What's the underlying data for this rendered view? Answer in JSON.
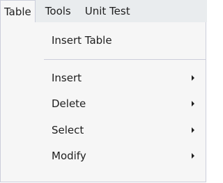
{
  "menubar": {
    "items": [
      {
        "label": "Table",
        "state": "open"
      },
      {
        "label": "Tools"
      },
      {
        "label": "Unit Test"
      }
    ]
  },
  "dropdown": {
    "items": [
      {
        "label": "Insert Table",
        "has_submenu": false
      },
      {
        "label": "Insert",
        "has_submenu": true
      },
      {
        "label": "Delete",
        "has_submenu": true
      },
      {
        "label": "Select",
        "has_submenu": true
      },
      {
        "label": "Modify",
        "has_submenu": true
      }
    ]
  },
  "colors": {
    "menubar_bg": "#e9ecee",
    "menu_bg": "#f6f6f6",
    "border": "#cccedb",
    "text": "#1e1e1e"
  }
}
